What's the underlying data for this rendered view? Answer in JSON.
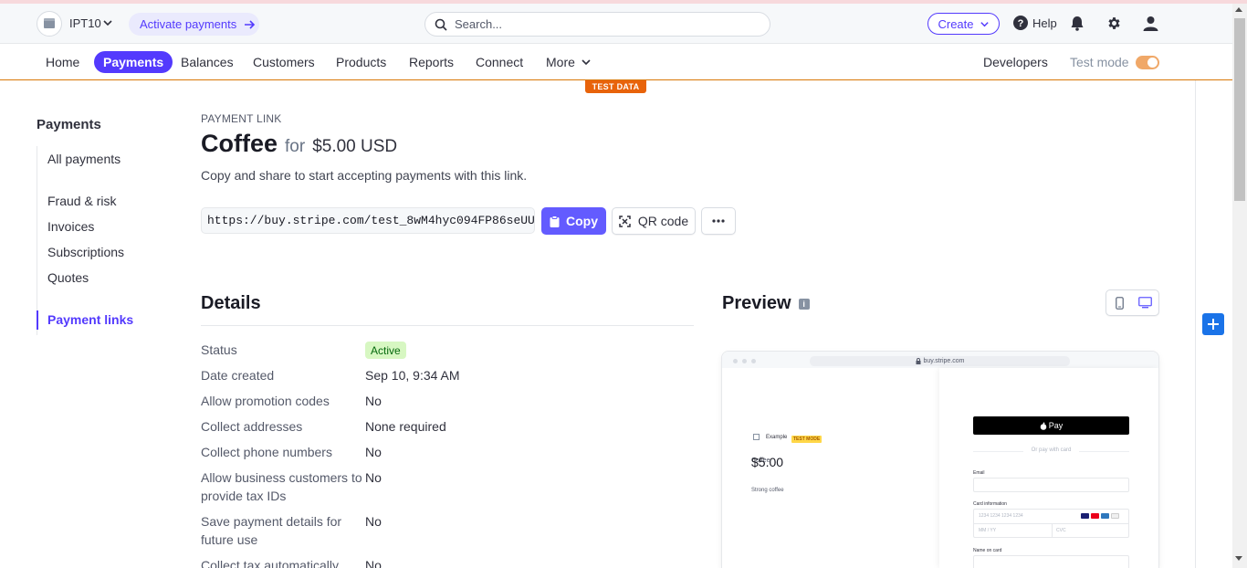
{
  "topbar": {
    "account_name": "IPT10",
    "activate_label": "Activate payments",
    "search_placeholder": "Search...",
    "create_label": "Create",
    "help_label": "Help"
  },
  "nav": {
    "items": [
      "Home",
      "Payments",
      "Balances",
      "Customers",
      "Products",
      "Reports",
      "Connect",
      "More"
    ],
    "active": "Payments",
    "developers_label": "Developers",
    "test_mode_label": "Test mode",
    "test_data_banner": "TEST DATA"
  },
  "sidebar": {
    "title": "Payments",
    "items": [
      "All payments",
      "Fraud & risk",
      "Invoices",
      "Subscriptions",
      "Quotes",
      "Payment links"
    ],
    "active": "Payment links"
  },
  "main": {
    "kicker": "PAYMENT LINK",
    "title": "Coffee",
    "title_for": "for",
    "price": "$5.00 USD",
    "subtitle": "Copy and share to start accepting payments with this link.",
    "url": "https://buy.stripe.com/test_8wM4hyc094FP86seUU",
    "copy_label": "Copy",
    "qr_label": "QR code"
  },
  "details": {
    "title": "Details",
    "rows": [
      {
        "label": "Status",
        "value": "Active"
      },
      {
        "label": "Date created",
        "value": "Sep 10, 9:34 AM"
      },
      {
        "label": "Allow promotion codes",
        "value": "No"
      },
      {
        "label": "Collect addresses",
        "value": "None required"
      },
      {
        "label": "Collect phone numbers",
        "value": "No"
      },
      {
        "label": "Allow business customers to provide tax IDs",
        "value": "No"
      },
      {
        "label": "Save payment details for future use",
        "value": "No"
      },
      {
        "label": "Collect tax automatically",
        "value": "No"
      }
    ]
  },
  "preview": {
    "title": "Preview",
    "address": "buy.stripe.com",
    "merchant": "Example",
    "test_mode": "TEST MODE",
    "product": "Coffee",
    "amount": "$5.00",
    "description": "Strong coffee",
    "apple_pay": "Pay",
    "or_pay": "Or pay with card",
    "email_label": "Email",
    "card_label": "Card information",
    "card_placeholder": "1234 1234 1234 1234",
    "expiry_placeholder": "MM / YY",
    "cvc_placeholder": "CVC",
    "name_label": "Name on card"
  },
  "colors": {
    "accent": "#635bff",
    "test_orange": "#e8630a",
    "active_green_bg": "#d7f7c2"
  }
}
